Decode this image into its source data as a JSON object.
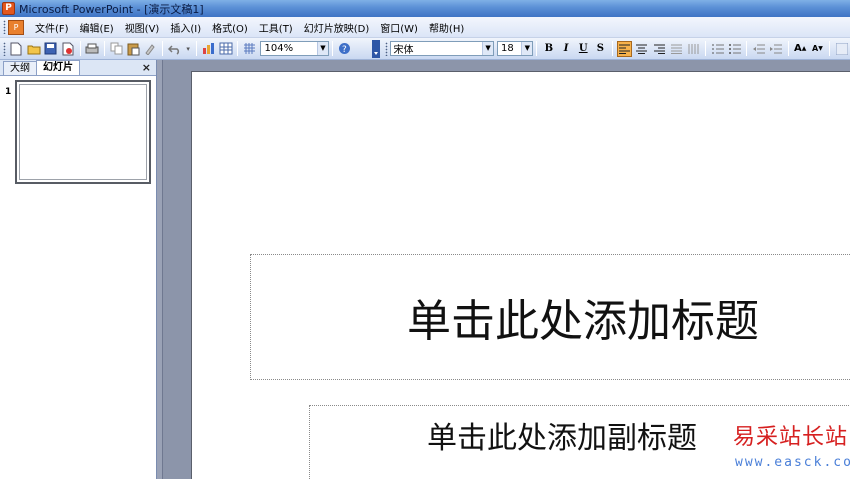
{
  "window": {
    "app_icon_label": "P",
    "title": "Microsoft PowerPoint - [演示文稿1]"
  },
  "menubar": {
    "doc_icon_label": "P",
    "items": [
      "文件(F)",
      "编辑(E)",
      "视图(V)",
      "插入(I)",
      "格式(O)",
      "工具(T)",
      "幻灯片放映(D)",
      "窗口(W)",
      "帮助(H)"
    ]
  },
  "toolbar": {
    "zoom": "104%",
    "font_name": "宋体",
    "font_size": "18",
    "bold": "B",
    "italic": "I",
    "underline": "U",
    "shadow": "S",
    "increase_font": "A",
    "decrease_font": "A"
  },
  "left_pane": {
    "tabs": [
      "大纲",
      "幻灯片"
    ],
    "active_tab": "幻灯片",
    "close": "×",
    "slide_number": "1"
  },
  "slide": {
    "title_placeholder": "单击此处添加标题",
    "subtitle_placeholder": "单击此处添加副标题"
  },
  "watermark": {
    "text": "易采站长站",
    "url": "www.easck.com"
  },
  "colors": {
    "titlebar": "#5a8fd6",
    "active_button": "#f7b24c",
    "workspace": "#8c95aa"
  }
}
